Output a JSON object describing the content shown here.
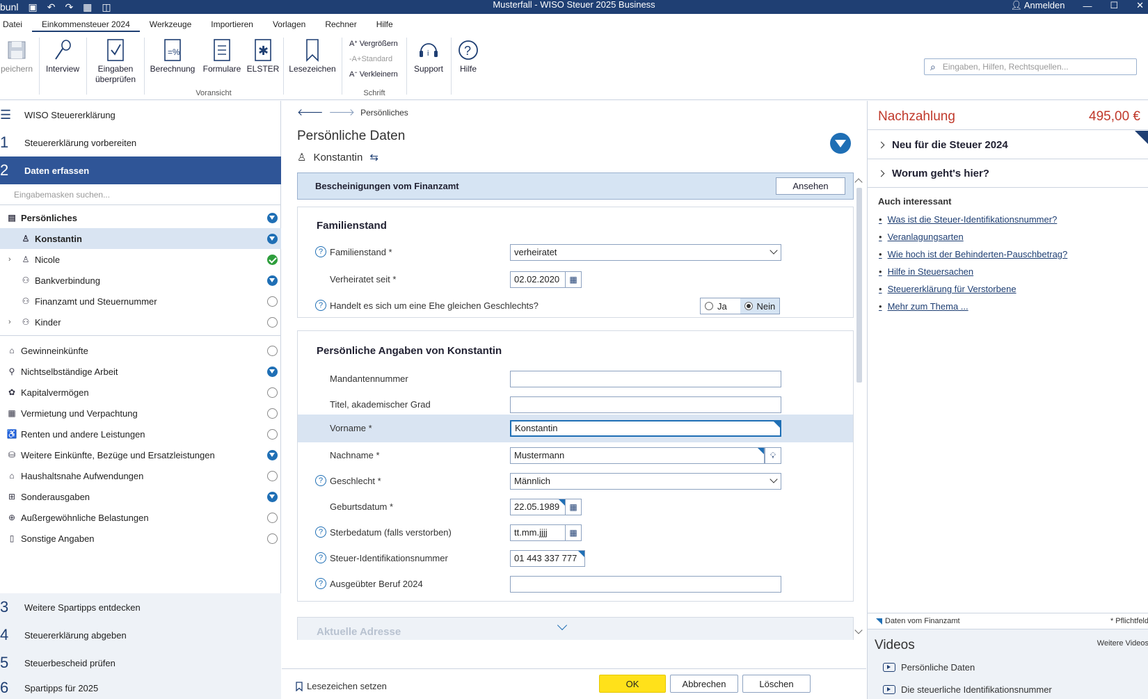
{
  "titlebar": {
    "left_fragment": "bunl",
    "title": "Musterfall - WISO Steuer 2025 Business",
    "login": "Anmelden"
  },
  "menu": [
    "Datei",
    "Einkommensteuer 2024",
    "Werkzeuge",
    "Importieren",
    "Vorlagen",
    "Rechner",
    "Hilfe"
  ],
  "ribbon": {
    "buttons": {
      "save": "peichern",
      "interview": "Interview",
      "check_line1": "Eingaben",
      "check_line2": "überprüfen",
      "calc": "Berechnung",
      "forms": "Formulare",
      "elster": "ELSTER",
      "bookmarks": "Lesezeichen",
      "support": "Support",
      "help": "Hilfe"
    },
    "font": {
      "bigger": "Vergrößern",
      "standard": "Standard",
      "smaller": "Verkleinern"
    },
    "groups": {
      "preview": "Voransicht",
      "font": "Schrift"
    },
    "search_placeholder": "Eingaben, Hilfen, Rechtsquellen..."
  },
  "nav": {
    "header": "WISO Steuererklärung",
    "steps_top": [
      {
        "num": "1",
        "label": "Steuererklärung vorbereiten"
      },
      {
        "num": "2",
        "label": "Daten erfassen"
      }
    ],
    "search_placeholder": "Eingabemasken suchen...",
    "items": [
      {
        "label": "Persönliches",
        "icon": "id-card-icon",
        "status": "blue"
      },
      {
        "label": "Konstantin",
        "icon": "person-icon",
        "status": "blue"
      },
      {
        "label": "Nicole",
        "icon": "person-icon",
        "status": "green"
      },
      {
        "label": "Bankverbindung",
        "icon": "people-icon",
        "status": "blue"
      },
      {
        "label": "Finanzamt und Steuernummer",
        "icon": "people-icon",
        "status": "empty"
      },
      {
        "label": "Kinder",
        "icon": "people-icon",
        "status": "empty"
      }
    ],
    "categories": [
      {
        "label": "Gewinneinkünfte",
        "icon": "shop-icon",
        "status": "empty"
      },
      {
        "label": "Nichtselbständige Arbeit",
        "icon": "briefcase-icon",
        "status": "blue"
      },
      {
        "label": "Kapitalvermögen",
        "icon": "coins-icon",
        "status": "empty"
      },
      {
        "label": "Vermietung und Verpachtung",
        "icon": "building-icon",
        "status": "empty"
      },
      {
        "label": "Renten und andere Leistungen",
        "icon": "pension-icon",
        "status": "empty"
      },
      {
        "label": "Weitere Einkünfte, Bezüge und Ersatzleistungen",
        "icon": "money-icon",
        "status": "blue"
      },
      {
        "label": "Haushaltsnahe Aufwendungen",
        "icon": "house-icon",
        "status": "empty"
      },
      {
        "label": "Sonderausgaben",
        "icon": "gift-icon",
        "status": "blue"
      },
      {
        "label": "Außergewöhnliche Belastungen",
        "icon": "medical-icon",
        "status": "empty"
      },
      {
        "label": "Sonstige Angaben",
        "icon": "document-icon",
        "status": "empty"
      }
    ],
    "steps_bottom": [
      {
        "num": "3",
        "label": "Weitere Spartipps entdecken"
      },
      {
        "num": "4",
        "label": "Steuererklärung abgeben"
      },
      {
        "num": "5",
        "label": "Steuerbescheid prüfen"
      },
      {
        "num": "6",
        "label": "Spartipps für 2025"
      }
    ]
  },
  "main": {
    "breadcrumb": "Persönliches",
    "title": "Persönliche Daten",
    "person": "Konstantin",
    "banner": {
      "text": "Bescheinigungen vom Finanzamt",
      "button": "Ansehen"
    },
    "familienstand": {
      "heading": "Familienstand",
      "status_label": "Familienstand *",
      "status_value": "verheiratet",
      "since_label": "Verheiratet seit *",
      "since_value": "02.02.2020",
      "same_sex_label": "Handelt es sich um eine Ehe gleichen Geschlechts?",
      "yes": "Ja",
      "no": "Nein",
      "selected": "Nein"
    },
    "angaben": {
      "heading": "Persönliche Angaben von Konstantin",
      "mandant_label": "Mandantennummer",
      "mandant_value": "",
      "titel_label": "Titel, akademischer Grad",
      "titel_value": "",
      "vorname_label": "Vorname *",
      "vorname_value": "Konstantin",
      "nachname_label": "Nachname *",
      "nachname_value": "Mustermann",
      "geschlecht_label": "Geschlecht *",
      "geschlecht_value": "Männlich",
      "geburt_label": "Geburtsdatum *",
      "geburt_value": "22.05.1989",
      "sterbe_label": "Sterbedatum (falls verstorben)",
      "sterbe_value": "tt.mm.jjjj",
      "steuerid_label": "Steuer-Identifikationsnummer",
      "steuerid_value": "01 443 337 777",
      "beruf_label": "Ausgeübter Beruf 2024",
      "beruf_value": ""
    },
    "address_heading": "Aktuelle Adresse",
    "footer": {
      "bookmark": "Lesezeichen setzen",
      "ok": "OK",
      "cancel": "Abbrechen",
      "delete": "Löschen"
    }
  },
  "right": {
    "nachzahlung_label": "Nachzahlung",
    "nachzahlung_value": "495,00 €",
    "acc1": "Neu für die Steuer 2024",
    "acc2": "Worum geht's hier?",
    "auch_label": "Auch interessant",
    "links": [
      "Was ist die Steuer-Identifikationsnummer?",
      "Veranlagungsarten",
      "Wie hoch ist der Behinderten-Pauschbetrag?",
      "Hilfe in Steuersachen",
      "Steuererklärung für Verstorbene",
      "Mehr zum Thema ..."
    ],
    "legend_left": "Daten vom Finanzamt",
    "legend_right": "* Pflichtfeld",
    "videos_label": "Videos",
    "videos_more": "Weitere Videos",
    "videos": [
      "Persönliche Daten",
      "Die steuerliche Identifikationsnummer"
    ]
  },
  "colors": {
    "brand": "#1f3f73",
    "accent": "#1f6fb5",
    "ok": "#ffe11a",
    "payment": "#c0392b"
  }
}
